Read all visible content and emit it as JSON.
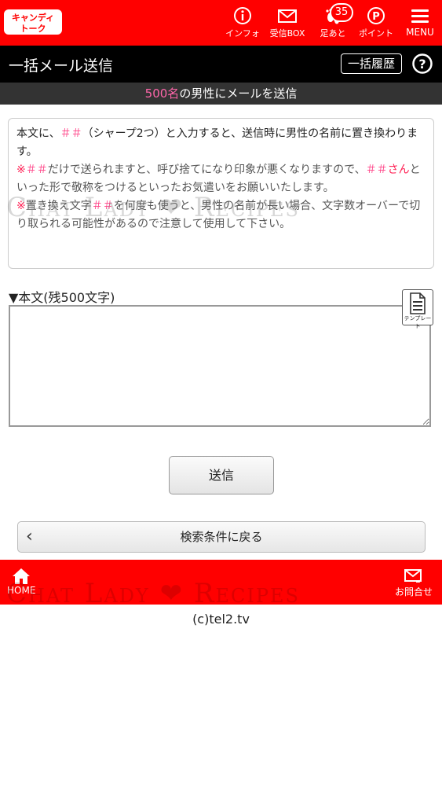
{
  "header": {
    "logo_text": "キャンディトーク",
    "nav": [
      {
        "label": "インフォ",
        "icon": "info-icon"
      },
      {
        "label": "受信BOX",
        "icon": "mail-icon"
      },
      {
        "label": "足あと",
        "icon": "footprint-icon"
      },
      {
        "label": "ポイント",
        "icon": "point-icon"
      },
      {
        "label": "MENU",
        "icon": "menu-icon"
      }
    ],
    "footprint_badge": "35"
  },
  "titlebar": {
    "title": "一括メール送信",
    "history_button": "一括履歴"
  },
  "subbar": {
    "count": "500名",
    "text": "の男性にメールを送信"
  },
  "info": {
    "line1_a": "本文に、",
    "line1_b": "＃＃",
    "line1_c": "（シャープ2つ）と入力すると、送信時に男性の名前に置き換わります。",
    "warn1_mark": "※",
    "warn1_a": "＃＃",
    "warn1_b": "だけで送られますと、呼び捨てになり印象が悪くなりますので、",
    "warn1_c": "＃＃",
    "warn1_d": "さん",
    "warn1_e": "といった形で敬称をつけるといったお気遣いをお願いいたします。",
    "warn2_mark": "※",
    "warn2_a": "置き換え文字",
    "warn2_b": "＃＃",
    "warn2_c": "を何度も使うと、男性の名前が長い場合、文字数オーバーで切り取られる可能性があるので注意して使用して下さい。"
  },
  "compose": {
    "label": "▼本文(残500文字)",
    "template_label": "テンプレート",
    "value": ""
  },
  "buttons": {
    "send": "送信",
    "back": "検索条件に戻る"
  },
  "footer": {
    "home": "HOME",
    "contact": "お問合せ",
    "copyright": "(c)tel2.tv"
  },
  "watermark": "Chat Lady ❤ Recipes",
  "colors": {
    "brand_red": "#ff0000",
    "title_black": "#000000",
    "accent_pink": "#ff66aa",
    "warning_red": "#ff2255"
  }
}
